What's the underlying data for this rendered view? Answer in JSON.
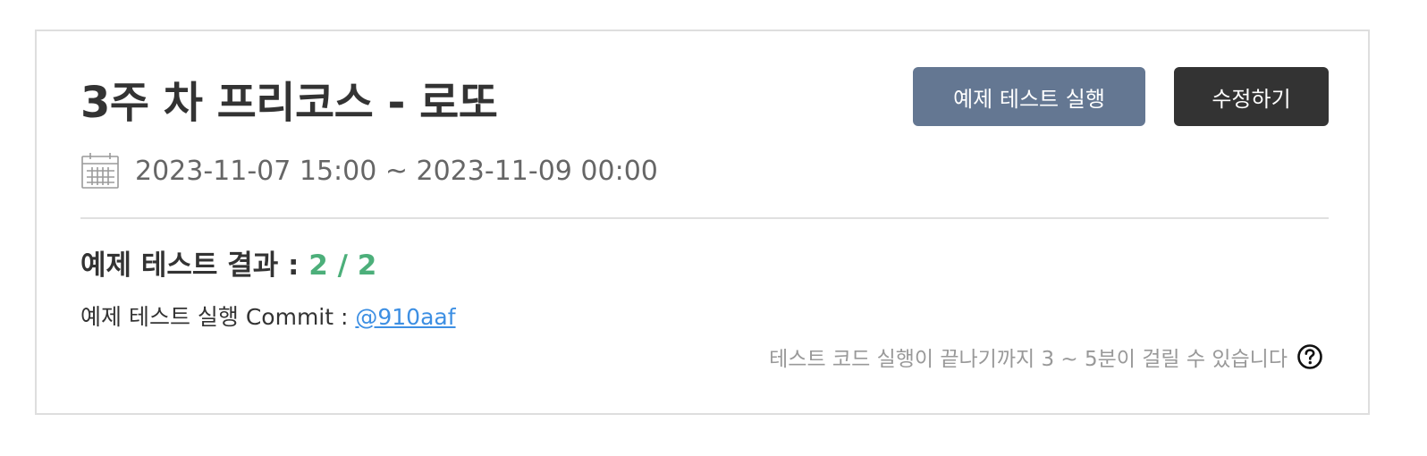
{
  "card": {
    "title": "3주 차 프리코스 - 로또",
    "buttons": {
      "run_example_test": "예제 테스트 실행",
      "edit": "수정하기"
    },
    "period": "2023-11-07 15:00 ~ 2023-11-09 00:00",
    "result": {
      "label": "예제 테스트 결과 : ",
      "value": "2 / 2"
    },
    "commit": {
      "label": "예제 테스트 실행 Commit : ",
      "link": "@910aaf"
    },
    "notice": "테스트 코드 실행이 끝나기까지 3 ~ 5분이 걸릴 수 있습니다"
  },
  "icons": {
    "calendar": "calendar-icon",
    "help": "question-circle-icon"
  },
  "colors": {
    "run_button": "#647792",
    "edit_button": "#333333",
    "result_value": "#4caf7a",
    "link": "#3d8fe3",
    "card_border": "#dedede"
  }
}
